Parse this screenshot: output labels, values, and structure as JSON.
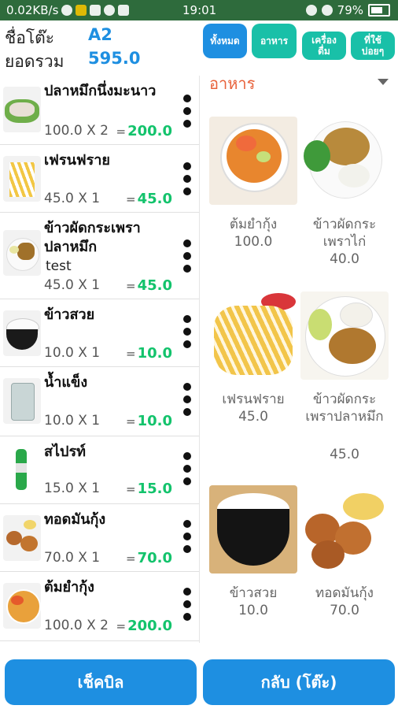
{
  "status_bar": {
    "speed": "0.02KB/s",
    "time": "19:01",
    "battery": "79%"
  },
  "header": {
    "table_label": "ชื่อโต๊ะ",
    "table_value": "A2",
    "total_label": "ยอดรวม",
    "total_value": "595.0"
  },
  "categories": [
    "ทั้งหมด",
    "อาหาร",
    "เครื่องดื่ม",
    "ที่ใช้บ่อยๆ"
  ],
  "active_category": "ทั้งหมด",
  "dropdown": {
    "selected": "อาหาร"
  },
  "order_items": [
    {
      "name": "ปลาหมึกนึ่งมะนาว",
      "note": "",
      "qty_text": "100.0 X 2",
      "total": "200.0"
    },
    {
      "name": "เฟรนฟราย",
      "note": "",
      "qty_text": "45.0 X 1",
      "total": "45.0"
    },
    {
      "name": "ข้าวผัดกระเพรา ปลาหมึก",
      "note": "test",
      "qty_text": "45.0 X 1",
      "total": "45.0"
    },
    {
      "name": "ข้าวสวย",
      "note": "",
      "qty_text": "10.0 X 1",
      "total": "10.0"
    },
    {
      "name": "น้ำแข็ง",
      "note": "",
      "qty_text": "10.0 X 1",
      "total": "10.0"
    },
    {
      "name": "สไปรท์",
      "note": "",
      "qty_text": "15.0 X 1",
      "total": "15.0"
    },
    {
      "name": "ทอดมันกุ้ง",
      "note": "",
      "qty_text": "70.0 X 1",
      "total": "70.0"
    },
    {
      "name": "ต้มยำกุ้ง",
      "note": "",
      "qty_text": "100.0 X 2",
      "total": "200.0"
    }
  ],
  "menu_items": [
    {
      "name": "ต้มยำกุ้ง",
      "price": "100.0"
    },
    {
      "name": "ข้าวผัดกระเพราไก่",
      "price": "40.0"
    },
    {
      "name": "เฟรนฟราย",
      "price": "45.0"
    },
    {
      "name": "ข้าวผัดกระเพราปลาหมึก",
      "price": "45.0"
    },
    {
      "name": "ข้าวสวย",
      "price": "10.0"
    },
    {
      "name": "ทอดมันกุ้ง",
      "price": "70.0"
    }
  ],
  "buttons": {
    "check_bill": "เช็คบิล",
    "back_table": "กลับ (โต๊ะ)"
  },
  "colors": {
    "accent_blue": "#1e8fe1",
    "accent_teal": "#19c0a8",
    "total_green": "#13c36c",
    "dropdown_orange": "#e8623b"
  }
}
